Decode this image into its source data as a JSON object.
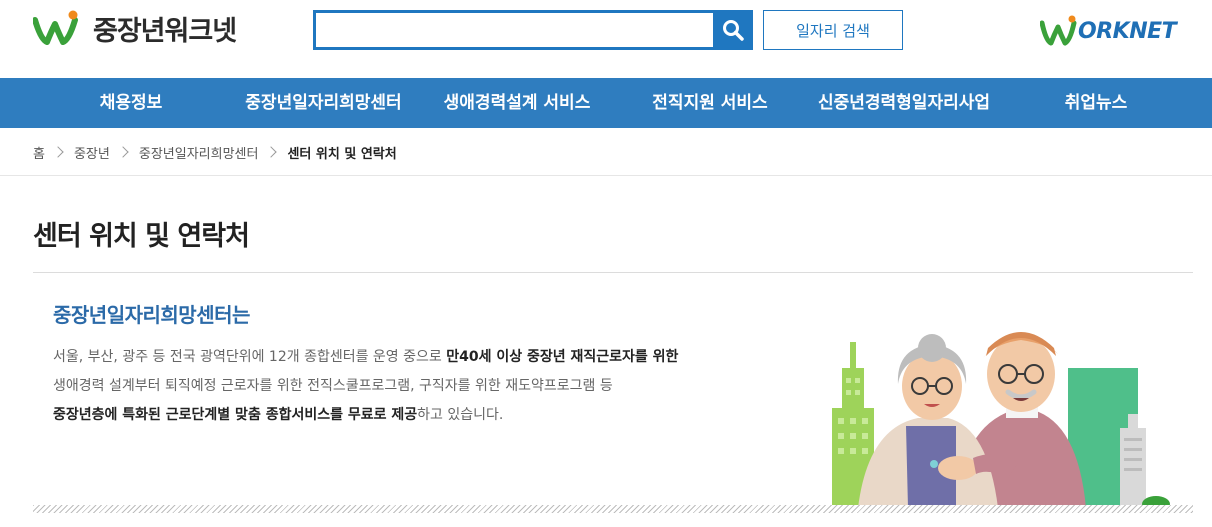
{
  "header": {
    "logo_text": "중장년워크넷",
    "search": {
      "value": "",
      "placeholder": ""
    },
    "job_search_label": "일자리 검색",
    "worknet_logo_text": "ORKNET"
  },
  "nav": {
    "items": [
      {
        "label": "채용정보"
      },
      {
        "label": "중장년일자리희망센터"
      },
      {
        "label": "생애경력설계 서비스"
      },
      {
        "label": "전직지원 서비스"
      },
      {
        "label": "신중년경력형일자리사업"
      },
      {
        "label": "취업뉴스"
      }
    ]
  },
  "breadcrumb": {
    "items": [
      "홈",
      "중장년",
      "중장년일자리희망센터",
      "센터 위치 및 연락처"
    ]
  },
  "page": {
    "title": "센터 위치 및 연락처",
    "section_title": "중장년일자리희망센터는",
    "line1_normal": "서울, 부산, 광주 등 전국 광역단위에 12개 종합센터를 운영 중으로 ",
    "line1_bold": "만40세 이상 중장년 재직근로자를 위한",
    "line2": "생애경력 설계부터 퇴직예정 근로자를 위한 전직스쿨프로그램, 구직자를 위한 재도약프로그램 등",
    "line3_bold": "중장년층에 특화된 근로단계별 맞춤 종합서비스를 무료로 제공",
    "line3_normal": "하고 있습니다."
  },
  "colors": {
    "brand_blue": "#1f77c0",
    "nav_blue": "#2f7dbf",
    "section_title": "#2b6aa8",
    "logo_green": "#3aa13a",
    "logo_orange": "#f08a1c"
  },
  "icons": {
    "search": "search-icon",
    "logo": "worknet-leaf-logo-icon"
  }
}
